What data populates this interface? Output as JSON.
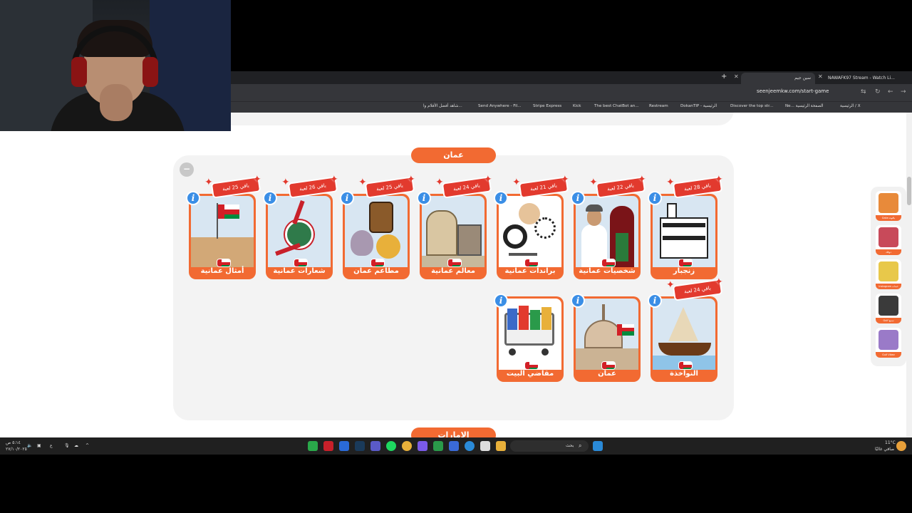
{
  "browser": {
    "tabs": [
      {
        "label": "سين جيم"
      },
      {
        "label": "NAWAFK97 Stream - Watch Li..."
      }
    ],
    "url": "seenjeemkw.com/start-game",
    "bookmarks": [
      "شاهد أفضل الأفلام وا...",
      "Send Anywhere - Fil...",
      "Stripe Express",
      "Kick",
      "The best ChatBot an...",
      "Restream",
      "DokanTIP - الرئيسية",
      "Discover the top str...",
      "Ne... الصفحة الرئيسية",
      "الرئيسية / X"
    ]
  },
  "sections": {
    "current": "عمان",
    "next": "الامارات"
  },
  "cards": [
    {
      "title": "زنجبار",
      "remaining": "باقي 28 لعبة"
    },
    {
      "title": "شخصيات عمانية",
      "remaining": "باقي 22 لعبة"
    },
    {
      "title": "براندات عمانية",
      "remaining": "باقي 21 لعبة"
    },
    {
      "title": "معالم عمانية",
      "remaining": "باقي 24 لعبة"
    },
    {
      "title": "مطاعم عمان",
      "remaining": "باقي 25 لعبة"
    },
    {
      "title": "شعارات عمانية",
      "remaining": "باقي 26 لعبة"
    },
    {
      "title": "أمثال عمانية",
      "remaining": "باقي 25 لعبة"
    },
    {
      "title": "النواخذة",
      "remaining": "باقي 24 لعبة"
    },
    {
      "title": "عمان",
      "remaining": ""
    },
    {
      "title": "مقاضي البيت",
      "remaining": ""
    }
  ],
  "collapse_symbol": "−",
  "info_symbol": "i",
  "sidebar": [
    {
      "caption": "Gaka ياقوتة"
    },
    {
      "caption": "ذوقك"
    },
    {
      "caption": "Instagram خبنات"
    },
    {
      "caption": "Gulf سمع"
    },
    {
      "caption": "Gulf Vibez"
    }
  ],
  "taskbar": {
    "search_placeholder": "بحث",
    "time": "٥:١٤ ص",
    "date": "٢٧/١٠/٢٠٢٥",
    "lang": "ع",
    "weather_temp": "11°C",
    "weather_desc": "صافي غالبًا"
  },
  "colors": {
    "accent": "#f26a32",
    "ribbon": "#e23a2e",
    "info": "#3a8ee6",
    "panel": "#f3f3f3"
  }
}
